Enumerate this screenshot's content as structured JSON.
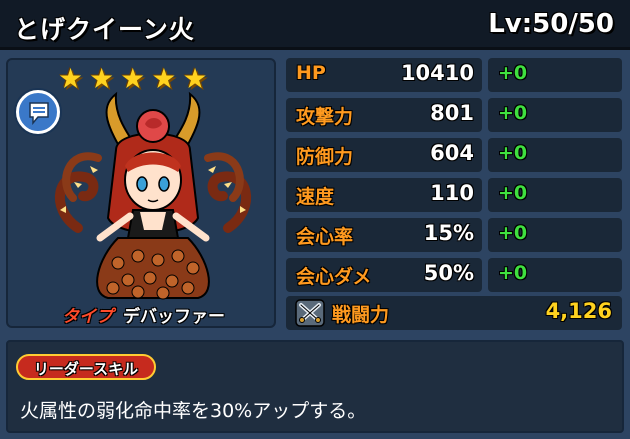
{
  "header": {
    "name": "とげクイーン火",
    "level": "Lv:50/50"
  },
  "character": {
    "stars": [
      "★",
      "★",
      "★",
      "★",
      "★"
    ],
    "star_count": 5,
    "chat_icon": "speech-bubble-icon",
    "type_label": "タイプ",
    "type_value": "デバッファー"
  },
  "stats": [
    {
      "label": "HP",
      "value": "10410",
      "bonus": "+0"
    },
    {
      "label": "攻撃力",
      "value": "801",
      "bonus": "+0"
    },
    {
      "label": "防御力",
      "value": "604",
      "bonus": "+0"
    },
    {
      "label": "速度",
      "value": "110",
      "bonus": "+0"
    },
    {
      "label": "会心率",
      "value": "15%",
      "bonus": "+0"
    },
    {
      "label": "会心ダメ",
      "value": "50%",
      "bonus": "+0"
    }
  ],
  "power": {
    "icon": "crossed-swords-icon",
    "label": "戦闘力",
    "value": "4,126"
  },
  "leader_skill": {
    "badge": "リーダースキル",
    "text": "火属性の弱化命中率を30%アップする。"
  },
  "colors": {
    "background": "#2d4462",
    "stat_label": "#ff9a1f",
    "bonus": "#3fe03f",
    "star": "#ffd21f",
    "type_label": "#ff4b2b",
    "skill_badge": "#c62a1e"
  }
}
